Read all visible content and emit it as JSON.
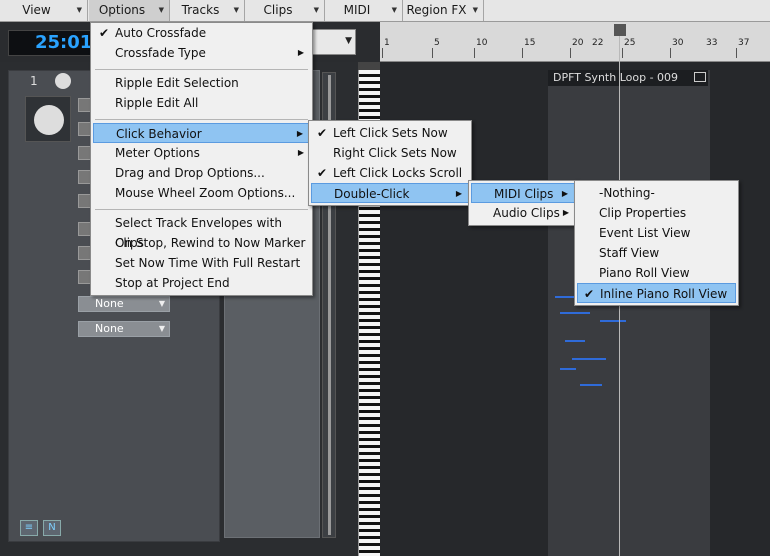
{
  "menubar": {
    "items": [
      {
        "label": "View"
      },
      {
        "label": "Options"
      },
      {
        "label": "Tracks"
      },
      {
        "label": "Clips"
      },
      {
        "label": "MIDI"
      },
      {
        "label": "Region FX"
      }
    ]
  },
  "transport": {
    "time": "25:01"
  },
  "ruler": {
    "labels": [
      "1",
      "5",
      "10",
      "15",
      "20",
      "22",
      "25",
      "30",
      "33",
      "37"
    ]
  },
  "track": {
    "number": "1",
    "dropdowns": [
      {
        "value": "None"
      },
      {
        "value": "None"
      }
    ]
  },
  "clip": {
    "title": "DPFT Synth Loop - 009"
  },
  "options_menu": {
    "items": [
      {
        "label": "Auto Crossfade",
        "checked": true
      },
      {
        "label": "Crossfade Type",
        "submenu": true
      },
      {
        "label": "Ripple Edit Selection"
      },
      {
        "label": "Ripple Edit All"
      },
      {
        "label": "Click Behavior",
        "submenu": true,
        "highlighted": true
      },
      {
        "label": "Meter Options",
        "submenu": true
      },
      {
        "label": "Drag and Drop Options..."
      },
      {
        "label": "Mouse Wheel Zoom Options..."
      },
      {
        "label": "Select Track Envelopes with Clips"
      },
      {
        "label": "On Stop, Rewind to Now Marker"
      },
      {
        "label": "Set Now Time With Full Restart"
      },
      {
        "label": "Stop at Project End"
      }
    ]
  },
  "click_behavior_menu": {
    "items": [
      {
        "label": "Left Click Sets Now",
        "checked": true
      },
      {
        "label": "Right Click Sets Now"
      },
      {
        "label": "Left Click Locks Scroll",
        "checked": true
      },
      {
        "label": "Double-Click",
        "submenu": true,
        "highlighted": true
      }
    ]
  },
  "double_click_menu": {
    "items": [
      {
        "label": "MIDI Clips",
        "submenu": true,
        "highlighted": true
      },
      {
        "label": "Audio Clips",
        "submenu": true
      }
    ]
  },
  "midi_clips_menu": {
    "items": [
      {
        "label": "-Nothing-"
      },
      {
        "label": "Clip Properties"
      },
      {
        "label": "Event List View"
      },
      {
        "label": "Staff View"
      },
      {
        "label": "Piano Roll View"
      },
      {
        "label": "Inline Piano Roll View",
        "checked": true,
        "highlighted": true
      }
    ]
  }
}
